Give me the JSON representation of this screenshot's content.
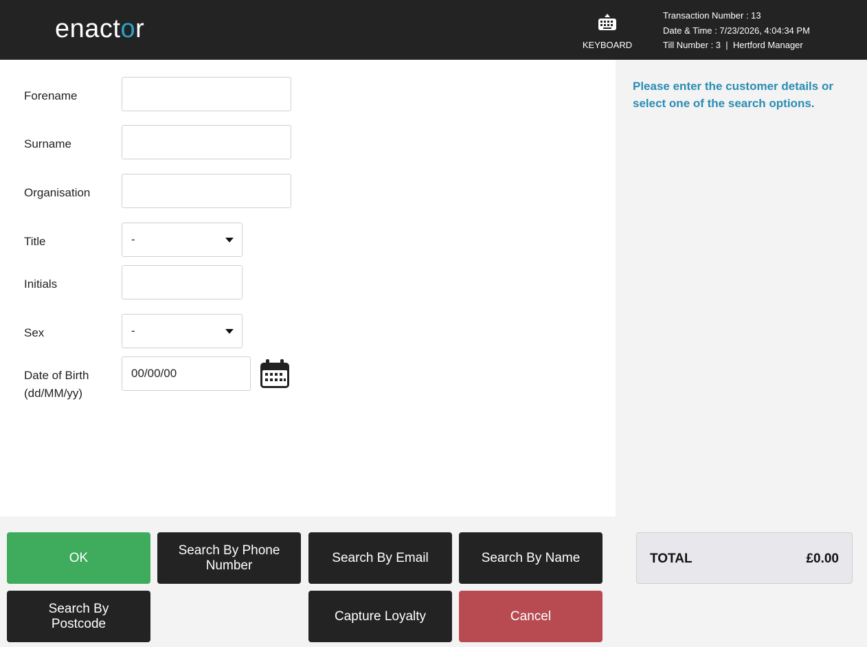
{
  "header": {
    "logo_text_pre": "enact",
    "logo_text_o": "o",
    "logo_text_post": "r",
    "keyboard_label": "KEYBOARD",
    "transaction_number": "Transaction Number : 13",
    "date_time": "Date & Time : 7/23/2026, 4:04:34 PM",
    "till": "Till Number : 3  |  Hertford Manager"
  },
  "form": {
    "forename_label": "Forename",
    "forename_value": "",
    "surname_label": "Surname",
    "surname_value": "",
    "organisation_label": "Organisation",
    "organisation_value": "",
    "title_label": "Title",
    "title_value": "-",
    "initials_label": "Initials",
    "initials_value": "",
    "sex_label": "Sex",
    "sex_value": "-",
    "dob_label_1": "Date of Birth",
    "dob_label_2": "(dd/MM/yy)",
    "dob_value": "00/00/00"
  },
  "side": {
    "message": "Please enter the customer details or select one of the search options."
  },
  "buttons": {
    "ok": "OK",
    "search_phone": "Search By Phone Number",
    "search_email": "Search By Email",
    "search_name": "Search By Name",
    "search_postcode": "Search By Postcode",
    "capture_loyalty": "Capture Loyalty",
    "cancel": "Cancel"
  },
  "total": {
    "label": "TOTAL",
    "value": "£0.00"
  },
  "colors": {
    "header_bg": "#232323",
    "accent": "#2a8db3",
    "ok_green": "#3fab5c",
    "cancel_red": "#b84b52"
  }
}
